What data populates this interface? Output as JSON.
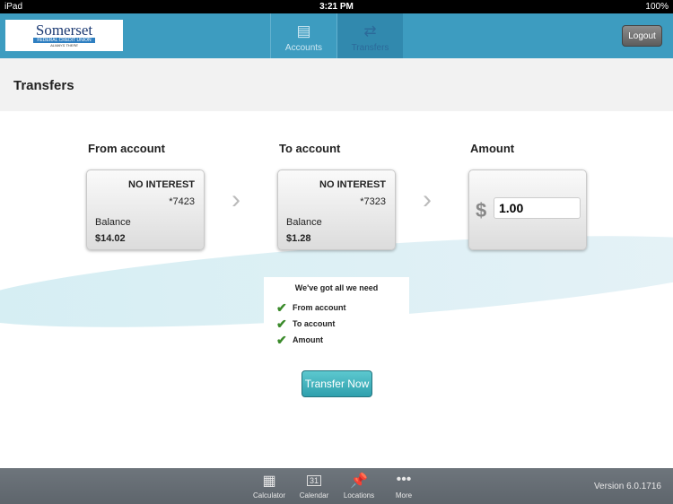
{
  "status": {
    "device": "iPad",
    "time": "3:21 PM",
    "battery": "100%"
  },
  "header": {
    "logo": {
      "name": "Somerset",
      "sub": "FEDERAL CREDIT UNION",
      "tag": "ALWAYS THERE"
    },
    "tabs": [
      {
        "label": "Accounts",
        "icon": "cards-icon"
      },
      {
        "label": "Transfers",
        "icon": "transfer-arrows-icon",
        "active": true
      }
    ],
    "logout": "Logout"
  },
  "page": {
    "title": "Transfers"
  },
  "from": {
    "label": "From account",
    "type": "NO INTEREST",
    "number": "*7423",
    "balance_label": "Balance",
    "balance": "$14.02"
  },
  "to": {
    "label": "To account",
    "type": "NO INTEREST",
    "number": "*7323",
    "balance_label": "Balance",
    "balance": "$1.28"
  },
  "amount": {
    "label": "Amount",
    "currency": "$",
    "value": "1.00"
  },
  "checklist": {
    "title": "We've got all we need",
    "items": [
      "From account",
      "To account",
      "Amount"
    ]
  },
  "transfer_button": "Transfer Now",
  "footer": {
    "items": [
      {
        "label": "Calculator",
        "icon": "calculator-icon"
      },
      {
        "label": "Calendar",
        "icon": "calendar-icon",
        "day": "31"
      },
      {
        "label": "Locations",
        "icon": "pushpin-icon"
      },
      {
        "label": "More",
        "icon": "more-icon"
      }
    ],
    "version": "Version 6.0.1716"
  }
}
